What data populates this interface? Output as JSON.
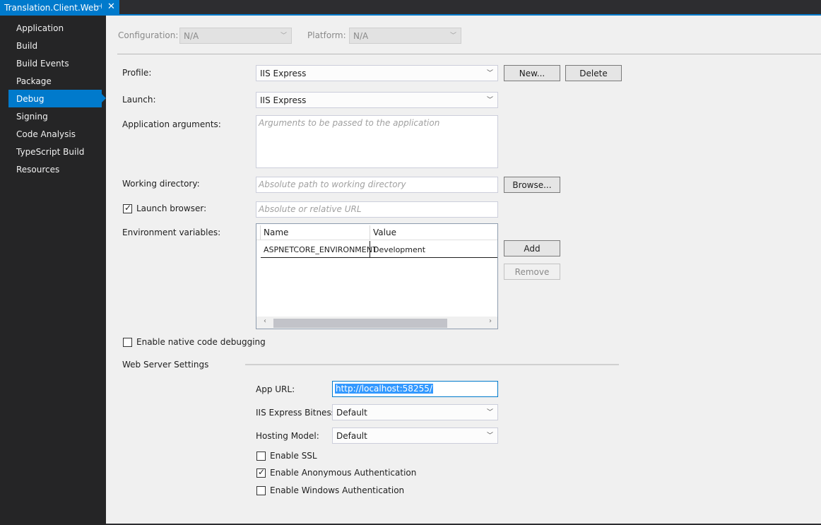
{
  "tab": {
    "title": "Translation.Client.Web",
    "pin_glyph": "⊣",
    "close_glyph": "✕"
  },
  "sidebar": {
    "items": [
      {
        "label": "Application"
      },
      {
        "label": "Build"
      },
      {
        "label": "Build Events"
      },
      {
        "label": "Package"
      },
      {
        "label": "Debug",
        "active": true
      },
      {
        "label": "Signing"
      },
      {
        "label": "Code Analysis"
      },
      {
        "label": "TypeScript Build"
      },
      {
        "label": "Resources"
      }
    ]
  },
  "config_bar": {
    "configuration_label": "Configuration:",
    "configuration_value": "N/A",
    "platform_label": "Platform:",
    "platform_value": "N/A"
  },
  "form": {
    "profile_label": "Profile:",
    "profile_value": "IIS Express",
    "new_button": "New...",
    "delete_button": "Delete",
    "launch_label": "Launch:",
    "launch_value": "IIS Express",
    "app_args_label": "Application arguments:",
    "app_args_placeholder": "Arguments to be passed to the application",
    "working_dir_label": "Working directory:",
    "working_dir_placeholder": "Absolute path to working directory",
    "browse_button": "Browse...",
    "launch_browser_label": "Launch browser:",
    "launch_browser_checked": true,
    "launch_browser_placeholder": "Absolute or relative URL",
    "env_vars_label": "Environment variables:",
    "env_columns": [
      "Name",
      "Value"
    ],
    "env_rows": [
      {
        "name": "ASPNETCORE_ENVIRONMENT",
        "value": "Development"
      }
    ],
    "add_button": "Add",
    "remove_button": "Remove",
    "native_debug_label": "Enable native code debugging",
    "native_debug_checked": false
  },
  "web_server": {
    "section_title": "Web Server Settings",
    "app_url_label": "App URL:",
    "app_url_value": "http://localhost:58255/",
    "bitness_label": "IIS Express Bitness:",
    "bitness_value": "Default",
    "hosting_label": "Hosting Model:",
    "hosting_value": "Default",
    "ssl_label": "Enable SSL",
    "ssl_checked": false,
    "anon_label": "Enable Anonymous Authentication",
    "anon_checked": true,
    "windows_label": "Enable Windows Authentication",
    "windows_checked": false
  },
  "colors": {
    "accent": "#007acc",
    "sidebar_bg": "#252526",
    "panel_bg": "#f0f0f0",
    "selection": "#3399ff"
  },
  "icons": {
    "chevron": "chevron-down-icon",
    "check": "checkmark-icon"
  }
}
